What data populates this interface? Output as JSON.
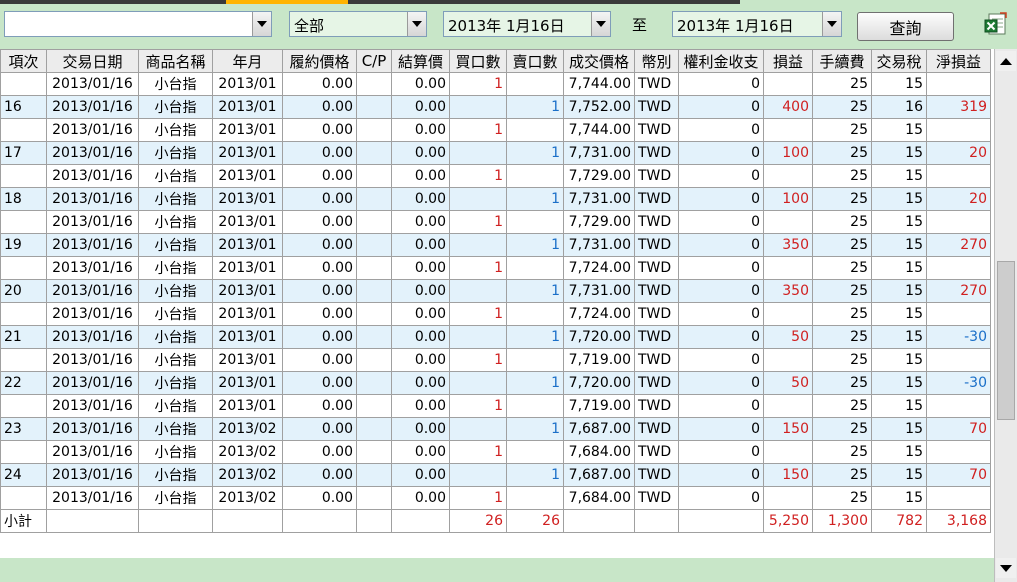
{
  "filters": {
    "account_value": "",
    "product_value": "全部",
    "date_from": "2013年  1月16日",
    "date_separator": "至",
    "date_to": "2013年  1月16日",
    "query_label": "查詢"
  },
  "icons": {
    "export": "excel-export-icon"
  },
  "colors": {
    "profit": "#d02020",
    "loss": "#1a6fc8",
    "alt_row": "#e3f2fb",
    "toolbar": "#c8e6c8"
  },
  "scroll": {
    "position": 0.58,
    "visible_fraction": 0.33
  },
  "table": {
    "columns": [
      "項次",
      "交易日期",
      "商品名稱",
      "年月",
      "履約價格",
      "C/P",
      "結算價",
      "買口數",
      "賣口數",
      "成交價格",
      "幣別",
      "權利金收支",
      "損益",
      "手續費",
      "交易稅",
      "淨損益"
    ],
    "rows": [
      {
        "no": "",
        "date": "2013/01/16",
        "product": "小台指",
        "ym": "2013/01",
        "strike": "0.00",
        "cp": "",
        "settle": "0.00",
        "buy": "1",
        "sell": "",
        "price": "7,744.00",
        "cur": "TWD",
        "premium": "0",
        "pnl": "",
        "fee": "25",
        "tax": "15",
        "net": ""
      },
      {
        "no": "16",
        "date": "2013/01/16",
        "product": "小台指",
        "ym": "2013/01",
        "strike": "0.00",
        "cp": "",
        "settle": "0.00",
        "buy": "",
        "sell": "1",
        "price": "7,752.00",
        "cur": "TWD",
        "premium": "0",
        "pnl": "400",
        "fee": "25",
        "tax": "16",
        "net": "319"
      },
      {
        "no": "",
        "date": "2013/01/16",
        "product": "小台指",
        "ym": "2013/01",
        "strike": "0.00",
        "cp": "",
        "settle": "0.00",
        "buy": "1",
        "sell": "",
        "price": "7,744.00",
        "cur": "TWD",
        "premium": "0",
        "pnl": "",
        "fee": "25",
        "tax": "15",
        "net": ""
      },
      {
        "no": "17",
        "date": "2013/01/16",
        "product": "小台指",
        "ym": "2013/01",
        "strike": "0.00",
        "cp": "",
        "settle": "0.00",
        "buy": "",
        "sell": "1",
        "price": "7,731.00",
        "cur": "TWD",
        "premium": "0",
        "pnl": "100",
        "fee": "25",
        "tax": "15",
        "net": "20"
      },
      {
        "no": "",
        "date": "2013/01/16",
        "product": "小台指",
        "ym": "2013/01",
        "strike": "0.00",
        "cp": "",
        "settle": "0.00",
        "buy": "1",
        "sell": "",
        "price": "7,729.00",
        "cur": "TWD",
        "premium": "0",
        "pnl": "",
        "fee": "25",
        "tax": "15",
        "net": ""
      },
      {
        "no": "18",
        "date": "2013/01/16",
        "product": "小台指",
        "ym": "2013/01",
        "strike": "0.00",
        "cp": "",
        "settle": "0.00",
        "buy": "",
        "sell": "1",
        "price": "7,731.00",
        "cur": "TWD",
        "premium": "0",
        "pnl": "100",
        "fee": "25",
        "tax": "15",
        "net": "20"
      },
      {
        "no": "",
        "date": "2013/01/16",
        "product": "小台指",
        "ym": "2013/01",
        "strike": "0.00",
        "cp": "",
        "settle": "0.00",
        "buy": "1",
        "sell": "",
        "price": "7,729.00",
        "cur": "TWD",
        "premium": "0",
        "pnl": "",
        "fee": "25",
        "tax": "15",
        "net": ""
      },
      {
        "no": "19",
        "date": "2013/01/16",
        "product": "小台指",
        "ym": "2013/01",
        "strike": "0.00",
        "cp": "",
        "settle": "0.00",
        "buy": "",
        "sell": "1",
        "price": "7,731.00",
        "cur": "TWD",
        "premium": "0",
        "pnl": "350",
        "fee": "25",
        "tax": "15",
        "net": "270"
      },
      {
        "no": "",
        "date": "2013/01/16",
        "product": "小台指",
        "ym": "2013/01",
        "strike": "0.00",
        "cp": "",
        "settle": "0.00",
        "buy": "1",
        "sell": "",
        "price": "7,724.00",
        "cur": "TWD",
        "premium": "0",
        "pnl": "",
        "fee": "25",
        "tax": "15",
        "net": ""
      },
      {
        "no": "20",
        "date": "2013/01/16",
        "product": "小台指",
        "ym": "2013/01",
        "strike": "0.00",
        "cp": "",
        "settle": "0.00",
        "buy": "",
        "sell": "1",
        "price": "7,731.00",
        "cur": "TWD",
        "premium": "0",
        "pnl": "350",
        "fee": "25",
        "tax": "15",
        "net": "270"
      },
      {
        "no": "",
        "date": "2013/01/16",
        "product": "小台指",
        "ym": "2013/01",
        "strike": "0.00",
        "cp": "",
        "settle": "0.00",
        "buy": "1",
        "sell": "",
        "price": "7,724.00",
        "cur": "TWD",
        "premium": "0",
        "pnl": "",
        "fee": "25",
        "tax": "15",
        "net": ""
      },
      {
        "no": "21",
        "date": "2013/01/16",
        "product": "小台指",
        "ym": "2013/01",
        "strike": "0.00",
        "cp": "",
        "settle": "0.00",
        "buy": "",
        "sell": "1",
        "price": "7,720.00",
        "cur": "TWD",
        "premium": "0",
        "pnl": "50",
        "fee": "25",
        "tax": "15",
        "net": "-30"
      },
      {
        "no": "",
        "date": "2013/01/16",
        "product": "小台指",
        "ym": "2013/01",
        "strike": "0.00",
        "cp": "",
        "settle": "0.00",
        "buy": "1",
        "sell": "",
        "price": "7,719.00",
        "cur": "TWD",
        "premium": "0",
        "pnl": "",
        "fee": "25",
        "tax": "15",
        "net": ""
      },
      {
        "no": "22",
        "date": "2013/01/16",
        "product": "小台指",
        "ym": "2013/01",
        "strike": "0.00",
        "cp": "",
        "settle": "0.00",
        "buy": "",
        "sell": "1",
        "price": "7,720.00",
        "cur": "TWD",
        "premium": "0",
        "pnl": "50",
        "fee": "25",
        "tax": "15",
        "net": "-30"
      },
      {
        "no": "",
        "date": "2013/01/16",
        "product": "小台指",
        "ym": "2013/01",
        "strike": "0.00",
        "cp": "",
        "settle": "0.00",
        "buy": "1",
        "sell": "",
        "price": "7,719.00",
        "cur": "TWD",
        "premium": "0",
        "pnl": "",
        "fee": "25",
        "tax": "15",
        "net": ""
      },
      {
        "no": "23",
        "date": "2013/01/16",
        "product": "小台指",
        "ym": "2013/02",
        "strike": "0.00",
        "cp": "",
        "settle": "0.00",
        "buy": "",
        "sell": "1",
        "price": "7,687.00",
        "cur": "TWD",
        "premium": "0",
        "pnl": "150",
        "fee": "25",
        "tax": "15",
        "net": "70"
      },
      {
        "no": "",
        "date": "2013/01/16",
        "product": "小台指",
        "ym": "2013/02",
        "strike": "0.00",
        "cp": "",
        "settle": "0.00",
        "buy": "1",
        "sell": "",
        "price": "7,684.00",
        "cur": "TWD",
        "premium": "0",
        "pnl": "",
        "fee": "25",
        "tax": "15",
        "net": ""
      },
      {
        "no": "24",
        "date": "2013/01/16",
        "product": "小台指",
        "ym": "2013/02",
        "strike": "0.00",
        "cp": "",
        "settle": "0.00",
        "buy": "",
        "sell": "1",
        "price": "7,687.00",
        "cur": "TWD",
        "premium": "0",
        "pnl": "150",
        "fee": "25",
        "tax": "15",
        "net": "70"
      },
      {
        "no": "",
        "date": "2013/01/16",
        "product": "小台指",
        "ym": "2013/02",
        "strike": "0.00",
        "cp": "",
        "settle": "0.00",
        "buy": "1",
        "sell": "",
        "price": "7,684.00",
        "cur": "TWD",
        "premium": "0",
        "pnl": "",
        "fee": "25",
        "tax": "15",
        "net": ""
      }
    ],
    "subtotal": {
      "label": "小計",
      "buy": "26",
      "sell": "26",
      "pnl": "5,250",
      "fee": "1,300",
      "tax": "782",
      "net": "3,168"
    }
  }
}
